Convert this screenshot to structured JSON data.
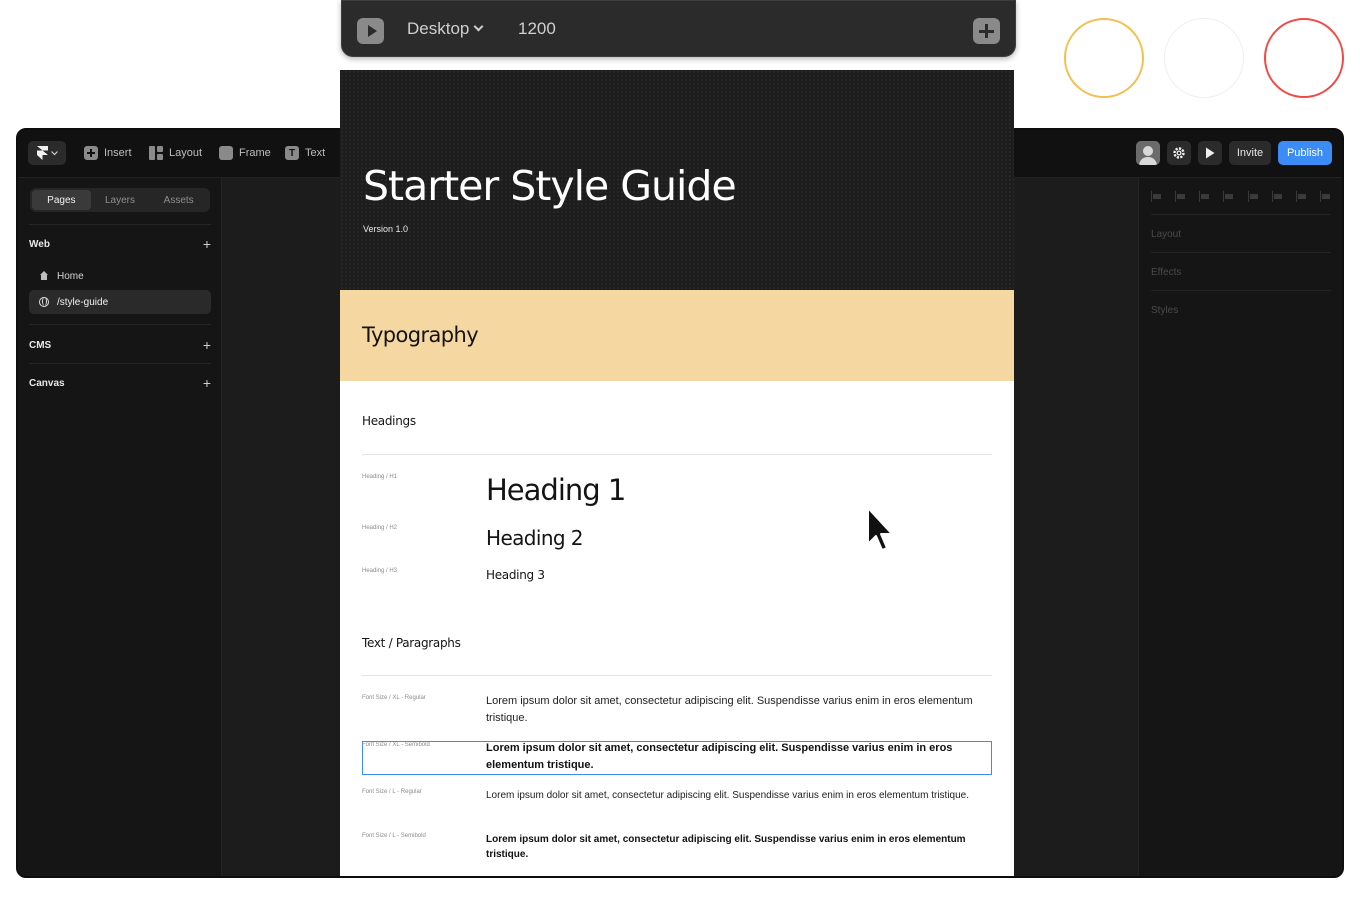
{
  "breakpoint_bar": {
    "device": "Desktop",
    "width": "1200"
  },
  "toolbar": {
    "insert": "Insert",
    "layout": "Layout",
    "frame": "Frame",
    "text": "Text",
    "invite": "Invite",
    "publish": "Publish"
  },
  "left_panel": {
    "tabs": [
      "Pages",
      "Layers",
      "Assets"
    ],
    "web_label": "Web",
    "pages": [
      "Home",
      "/style-guide"
    ],
    "cms_label": "CMS",
    "canvas_label": "Canvas"
  },
  "right_panel": {
    "sections": [
      "Layout",
      "Effects",
      "Styles"
    ]
  },
  "page": {
    "title": "Starter Style Guide",
    "version": "Version 1.0",
    "section_title": "Typography",
    "headings_label": "Headings",
    "heading_rows": [
      {
        "tag": "Heading / H1",
        "sample": "Heading 1"
      },
      {
        "tag": "Heading / H2",
        "sample": "Heading 2"
      },
      {
        "tag": "Heading / H3",
        "sample": "Heading 3"
      }
    ],
    "text_label": "Text / Paragraphs",
    "paragraph_rows": [
      {
        "tag": "Font Size / XL - Regular",
        "text": "Lorem ipsum dolor sit amet, consectetur adipiscing elit. Suspendisse varius enim in eros elementum tristique."
      },
      {
        "tag": "Font Size / XL - Semibold",
        "text": "Lorem ipsum dolor sit amet, consectetur adipiscing elit. Suspendisse varius enim in eros elementum tristique."
      },
      {
        "tag": "Font Size / L - Regular",
        "text": "Lorem ipsum dolor sit amet, consectetur adipiscing elit. Suspendisse varius enim in eros elementum tristique."
      },
      {
        "tag": "Font Size / L - Semibold",
        "text": "Lorem ipsum dolor sit amet, consectetur adipiscing elit. Suspendisse varius enim in eros elementum tristique."
      }
    ]
  },
  "colors": {
    "accent": "#3b8cf5",
    "typography_band": "#f5d7a1",
    "circle_yellow": "#f0c050",
    "circle_white": "#eeeeee",
    "circle_red": "#ef4a45"
  },
  "icons": {
    "framer_logo": "framer-logo-icon",
    "play": "play-icon",
    "settings": "gear-icon",
    "add": "plus-icon"
  }
}
